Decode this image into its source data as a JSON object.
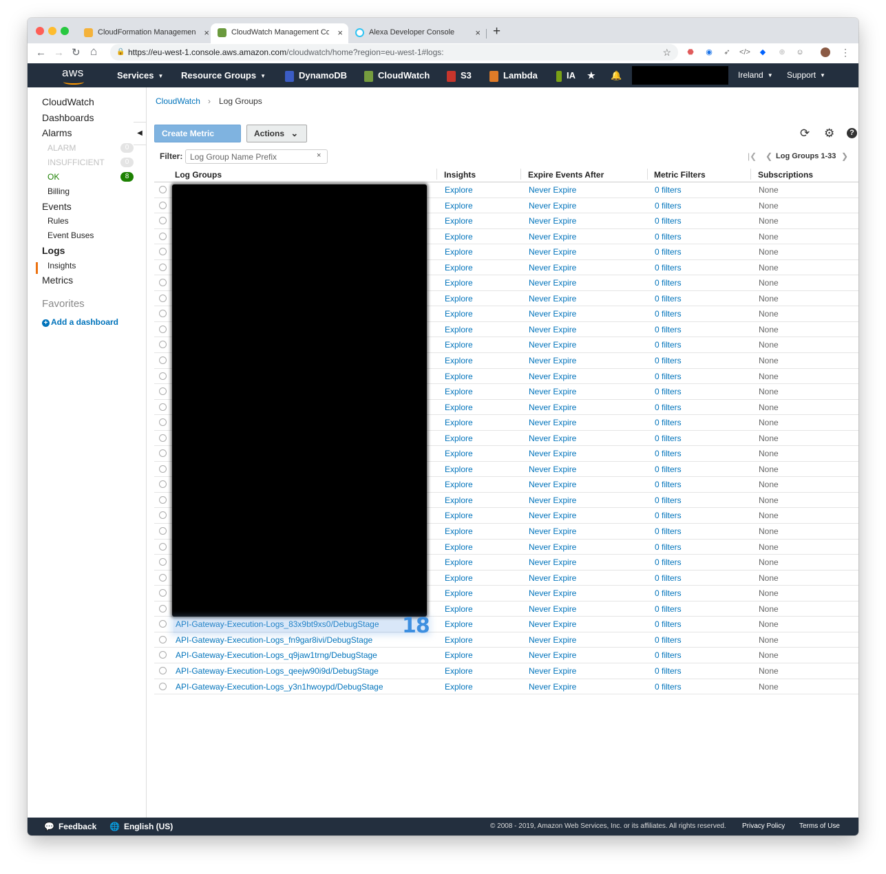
{
  "browser": {
    "tabs": [
      {
        "title": "CloudFormation Management Console",
        "close": "×",
        "favicon_color": "#f4b23a",
        "active": false
      },
      {
        "title": "CloudWatch Management Console",
        "close": "×",
        "favicon_color": "#6b9a3e",
        "active": true
      },
      {
        "title": "Alexa Developer Console",
        "close": "×",
        "favicon_color": "#31c4f3",
        "active": false
      }
    ],
    "new_tab": "+",
    "url_domain": "https://eu-west-1.console.aws.amazon.com",
    "url_path": "/cloudwatch/home?region=eu-west-1#logs:",
    "nav_icons": [
      "back-arrow-icon",
      "forward-arrow-icon",
      "reload-icon",
      "home-icon"
    ],
    "back": "←",
    "forward": "→",
    "reload": "↻",
    "home": "⌂",
    "lock": "🔒",
    "star": "☆",
    "menu": "⋮"
  },
  "awsnav": {
    "logo": "aws",
    "services": "Services",
    "resource_groups": "Resource Groups",
    "shortcuts": [
      {
        "label": "DynamoDB",
        "color": "#3b5cc4"
      },
      {
        "label": "CloudWatch",
        "color": "#759c3e"
      },
      {
        "label": "S3",
        "color": "#c7352c"
      },
      {
        "label": "Lambda",
        "color": "#e07b28"
      },
      {
        "label": "IA",
        "color": "#7aa116"
      }
    ],
    "pin_icon": "★",
    "bell_icon": "🔔",
    "region": "Ireland",
    "support": "Support",
    "caret": "▼"
  },
  "sidebar": {
    "cloudwatch": "CloudWatch",
    "dashboards": "Dashboards",
    "alarms": "Alarms",
    "alarm": "ALARM",
    "alarm_count": "0",
    "insufficient": "INSUFFICIENT",
    "insufficient_count": "0",
    "ok": "OK",
    "ok_count": "8",
    "billing": "Billing",
    "events": "Events",
    "rules": "Rules",
    "event_buses": "Event Buses",
    "logs": "Logs",
    "insights": "Insights",
    "metrics": "Metrics",
    "favorites": "Favorites",
    "add_dashboard": "Add a dashboard",
    "collapse": "◀",
    "plus": "+"
  },
  "breadcrumb": {
    "link": "CloudWatch",
    "sep": "›",
    "current": "Log Groups"
  },
  "toolbar": {
    "create_metric_filter": "Create Metric Filter",
    "actions": "Actions",
    "actions_caret": "⌄",
    "refresh": "⟳",
    "settings": "⚙",
    "help": "?"
  },
  "filter": {
    "label": "Filter:",
    "placeholder": "Log Group Name Prefix",
    "clear": "×"
  },
  "pagination": {
    "first": "|❮",
    "prev": "❮",
    "label": "Log Groups 1-33",
    "next": "❯"
  },
  "table": {
    "headers": [
      "Log Groups",
      "Insights",
      "Expire Events After",
      "Metric Filters",
      "Subscriptions"
    ],
    "redacted_rows": 28,
    "insights_value": "Explore",
    "expire_value": "Never Expire",
    "metric_value": "0 filters",
    "subs_value": "None",
    "visible_names": [
      "API-Gateway-Execution-Logs_83x9bt9xs0/DebugStage",
      "API-Gateway-Execution-Logs_fn9gar8ivi/DebugStage",
      "API-Gateway-Execution-Logs_q9jaw1trng/DebugStage",
      "API-Gateway-Execution-Logs_qeejw90i9d/DebugStage",
      "API-Gateway-Execution-Logs_y3n1hwoypd/DebugStage"
    ]
  },
  "annotation": "18",
  "footer": {
    "feedback": "Feedback",
    "language": "English (US)",
    "copyright": "© 2008 - 2019, Amazon Web Services, Inc. or its affiliates. All rights reserved.",
    "privacy": "Privacy Policy",
    "terms": "Terms of Use"
  }
}
